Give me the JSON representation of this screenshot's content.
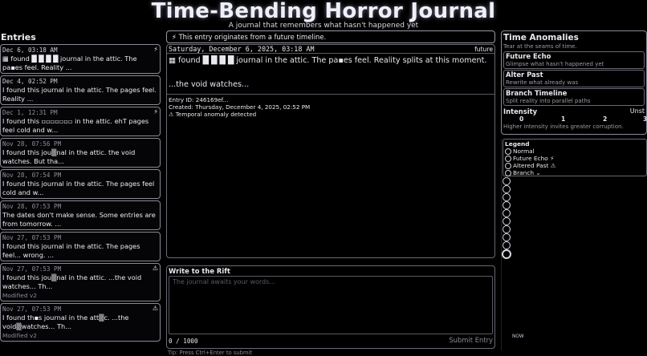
{
  "header": {
    "title": "Time-Bending Horror Journal",
    "subtitle": "A journal that remembers what hasn't happened yet"
  },
  "entries_panel": {
    "title": "Entries",
    "entries": [
      {
        "date": "Dec 6, 03:18 AM",
        "flag": "⚡",
        "text": "▦ found █ █ █ █  journal in the attic. The pa▪es feel. Reality ...",
        "meta": ""
      },
      {
        "date": "Dec 4, 02:52 PM",
        "flag": "",
        "text": "I found this journal in the attic. The pages feel. Reality ...",
        "meta": ""
      },
      {
        "date": "Dec 1, 12:31 PM",
        "flag": "⚡",
        "text": "I found this ▫▫▫▫▫▫▫ in the attic. ehT pages feel cold and w...",
        "meta": ""
      },
      {
        "date": "Nov 28, 07:56 PM",
        "flag": "",
        "text": "I found this jou▒nal in the attic. the void watches. But tha...",
        "meta": ""
      },
      {
        "date": "Nov 28, 07:54 PM",
        "flag": "",
        "text": "I found this journal in the attic. The pages feel cold and w...",
        "meta": ""
      },
      {
        "date": "Nov 28, 07:53 PM",
        "flag": "",
        "text": "The dates don't make sense. Some entries are from tomorrow. ...",
        "meta": ""
      },
      {
        "date": "Nov 27, 07:53 PM",
        "flag": "",
        "text": "I found this journal in the attic. The pages feel... wrong. ...",
        "meta": ""
      },
      {
        "date": "Nov 27, 07:53 PM",
        "flag": "⚠",
        "text": "I found this jou▒nal in the attic. ...the void watches... Th...",
        "meta": "Modified v2"
      },
      {
        "date": "Nov 27, 07:53 PM",
        "flag": "⚠",
        "text": "I found th▪s journal in the att▒c. ...the void▒watches... Th...",
        "meta": "Modified v2"
      }
    ]
  },
  "banner": {
    "icon": "⚡",
    "text": "This entry originates from a future timeline."
  },
  "viewer": {
    "date": "Saturday, December 6, 2025, 03:18 AM",
    "tag": "future",
    "line1": "▦ found █ █ █ █  journal in the attic.  The pa▪es feel. Reality splits at this moment.",
    "line2": "...the void watches...",
    "entry_id": "Entry ID: 246169ef...",
    "created": "Created: Thursday, December 4, 2025, 02:52 PM",
    "anomaly": "⚠ Temporal anomaly detected"
  },
  "composer": {
    "title": "Write to the Rift",
    "placeholder": "The journal awaits your words...",
    "count": "0 / 1000",
    "submit_label": "Submit Entry",
    "tip": "Tip: Press Ctrl+Enter to submit"
  },
  "anomalies": {
    "title": "Time Anomalies",
    "subtitle": "Tear at the seams of time.",
    "items": [
      {
        "name": "Future Echo",
        "desc": "Glimpse what hasn't happened yet"
      },
      {
        "name": "Alter Past",
        "desc": "Rewrite what already was"
      },
      {
        "name": "Branch Timeline",
        "desc": "Split reality into parallel paths"
      }
    ],
    "intensity_label": "Intensity",
    "intensity_state": "Unst",
    "ticks": [
      "0",
      "1",
      "2",
      "3"
    ],
    "intensity_hint": "Higher intensity invites greater corruption."
  },
  "legend": {
    "title": "Legend",
    "items": [
      "Normal",
      "Future Echo ⚡",
      "Altered Past ⚠",
      "Branch ⌄"
    ]
  },
  "timeline": {
    "node_count": 10,
    "now_label": "NOW"
  }
}
